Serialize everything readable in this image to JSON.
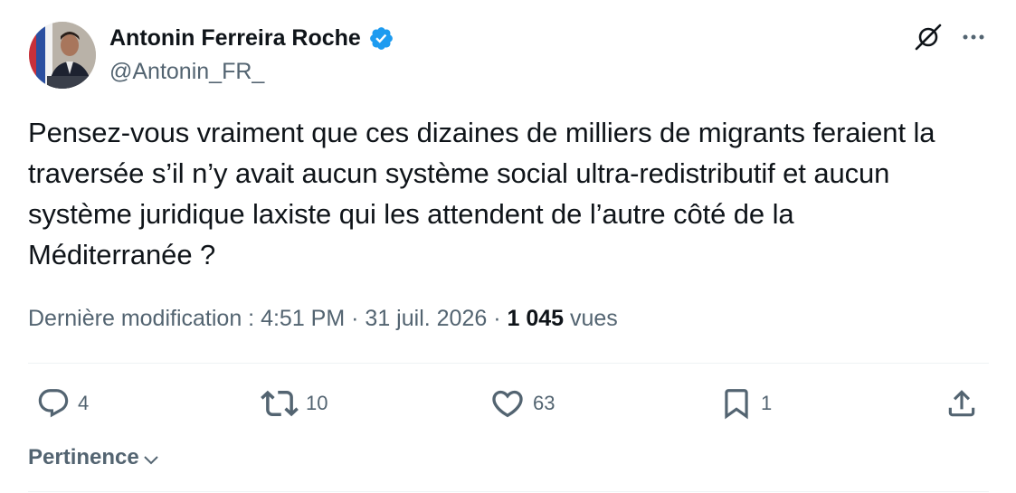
{
  "author": {
    "name": "Antonin Ferreira Roche",
    "handle": "@Antonin_FR_",
    "verified": true
  },
  "tweet": {
    "text": "Pensez-vous vraiment que ces dizaines de milliers de migrants feraient la\ntraversée s’il n’y avait aucun système social ultra-redistributif et aucun\nsystème juridique laxiste qui les attendent de l’autre côté de la\nMéditerranée ?"
  },
  "meta": {
    "edited_label": "Dernière modification :",
    "time": "4:51 PM",
    "separator": "·",
    "date": "31 juil. 2026",
    "views_count": "1 045",
    "views_label": "vues"
  },
  "actions": {
    "replies": "4",
    "reposts": "10",
    "likes": "63",
    "bookmarks": "1"
  },
  "sort": {
    "label": "Pertinence"
  },
  "colors": {
    "text": "#0f1419",
    "secondary": "#536471",
    "verified": "#1d9bf0",
    "divider": "#eff3f4"
  },
  "icons": {
    "verified": "verified-badge-icon",
    "grok": "grok-icon",
    "more": "more-icon",
    "reply": "reply-icon",
    "repost": "repost-icon",
    "like": "heart-icon",
    "bookmark": "bookmark-icon",
    "share": "share-icon",
    "sort": "chevron-down-icon"
  }
}
